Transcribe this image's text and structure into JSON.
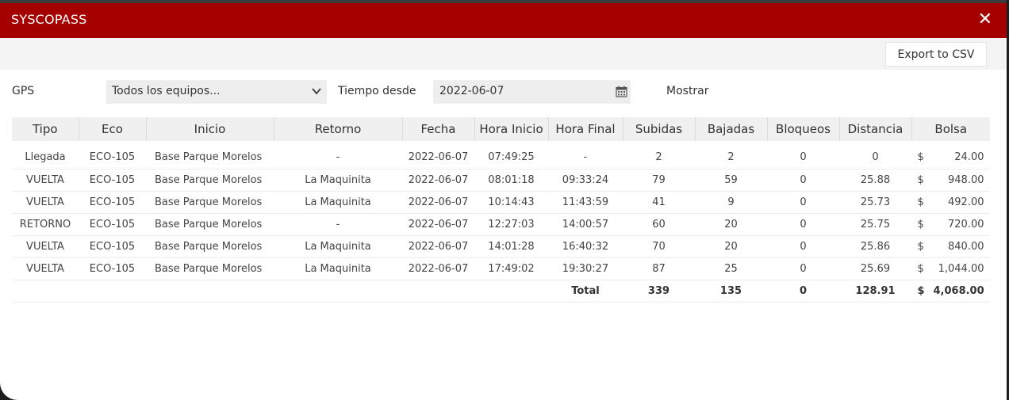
{
  "window": {
    "title": "SYSCOPASS",
    "close_glyph": "✕"
  },
  "toolbar": {
    "export_label": "Export to CSV"
  },
  "filters": {
    "gps_label": "GPS",
    "gps_selected": "Todos los equipos...",
    "tiempo_label": "Tiempo desde",
    "date_value": "2022-06-07",
    "mostrar_label": "Mostrar"
  },
  "table": {
    "columns": [
      "Tipo",
      "Eco",
      "Inicio",
      "Retorno",
      "Fecha",
      "Hora Inicio",
      "Hora Final",
      "Subidas",
      "Bajadas",
      "Bloqueos",
      "Distancia",
      "Bolsa"
    ],
    "rows": [
      {
        "tipo": "Llegada",
        "eco": "ECO-105",
        "inicio": "Base Parque Morelos",
        "retorno": "-",
        "fecha": "2022-06-07",
        "hora_inicio": "07:49:25",
        "hora_final": "-",
        "subidas": "2",
        "bajadas": "2",
        "bloqueos": "0",
        "distancia": "0",
        "bolsa_symbol": "$",
        "bolsa": "24.00"
      },
      {
        "tipo": "VUELTA",
        "eco": "ECO-105",
        "inicio": "Base Parque Morelos",
        "retorno": "La Maquinita",
        "fecha": "2022-06-07",
        "hora_inicio": "08:01:18",
        "hora_final": "09:33:24",
        "subidas": "79",
        "bajadas": "59",
        "bloqueos": "0",
        "distancia": "25.88",
        "bolsa_symbol": "$",
        "bolsa": "948.00"
      },
      {
        "tipo": "VUELTA",
        "eco": "ECO-105",
        "inicio": "Base Parque Morelos",
        "retorno": "La Maquinita",
        "fecha": "2022-06-07",
        "hora_inicio": "10:14:43",
        "hora_final": "11:43:59",
        "subidas": "41",
        "bajadas": "9",
        "bloqueos": "0",
        "distancia": "25.73",
        "bolsa_symbol": "$",
        "bolsa": "492.00"
      },
      {
        "tipo": "RETORNO",
        "eco": "ECO-105",
        "inicio": "Base Parque Morelos",
        "retorno": "-",
        "fecha": "2022-06-07",
        "hora_inicio": "12:27:03",
        "hora_final": "14:00:57",
        "subidas": "60",
        "bajadas": "20",
        "bloqueos": "0",
        "distancia": "25.75",
        "bolsa_symbol": "$",
        "bolsa": "720.00"
      },
      {
        "tipo": "VUELTA",
        "eco": "ECO-105",
        "inicio": "Base Parque Morelos",
        "retorno": "La Maquinita",
        "fecha": "2022-06-07",
        "hora_inicio": "14:01:28",
        "hora_final": "16:40:32",
        "subidas": "70",
        "bajadas": "20",
        "bloqueos": "0",
        "distancia": "25.86",
        "bolsa_symbol": "$",
        "bolsa": "840.00"
      },
      {
        "tipo": "VUELTA",
        "eco": "ECO-105",
        "inicio": "Base Parque Morelos",
        "retorno": "La Maquinita",
        "fecha": "2022-06-07",
        "hora_inicio": "17:49:02",
        "hora_final": "19:30:27",
        "subidas": "87",
        "bajadas": "25",
        "bloqueos": "0",
        "distancia": "25.69",
        "bolsa_symbol": "$",
        "bolsa": "1,044.00"
      }
    ],
    "totals": {
      "label": "Total",
      "subidas": "339",
      "bajadas": "135",
      "bloqueos": "0",
      "distancia": "128.91",
      "bolsa_symbol": "$",
      "bolsa": "4,068.00"
    }
  },
  "icons": {
    "dropdown": "chevron-down-icon",
    "date": "calendar-icon",
    "close": "close-icon"
  },
  "colors": {
    "titlebar": "#a50000",
    "toolbar": "#f4f4f4",
    "header": "#f0f0f0",
    "input": "#eeeeee"
  }
}
